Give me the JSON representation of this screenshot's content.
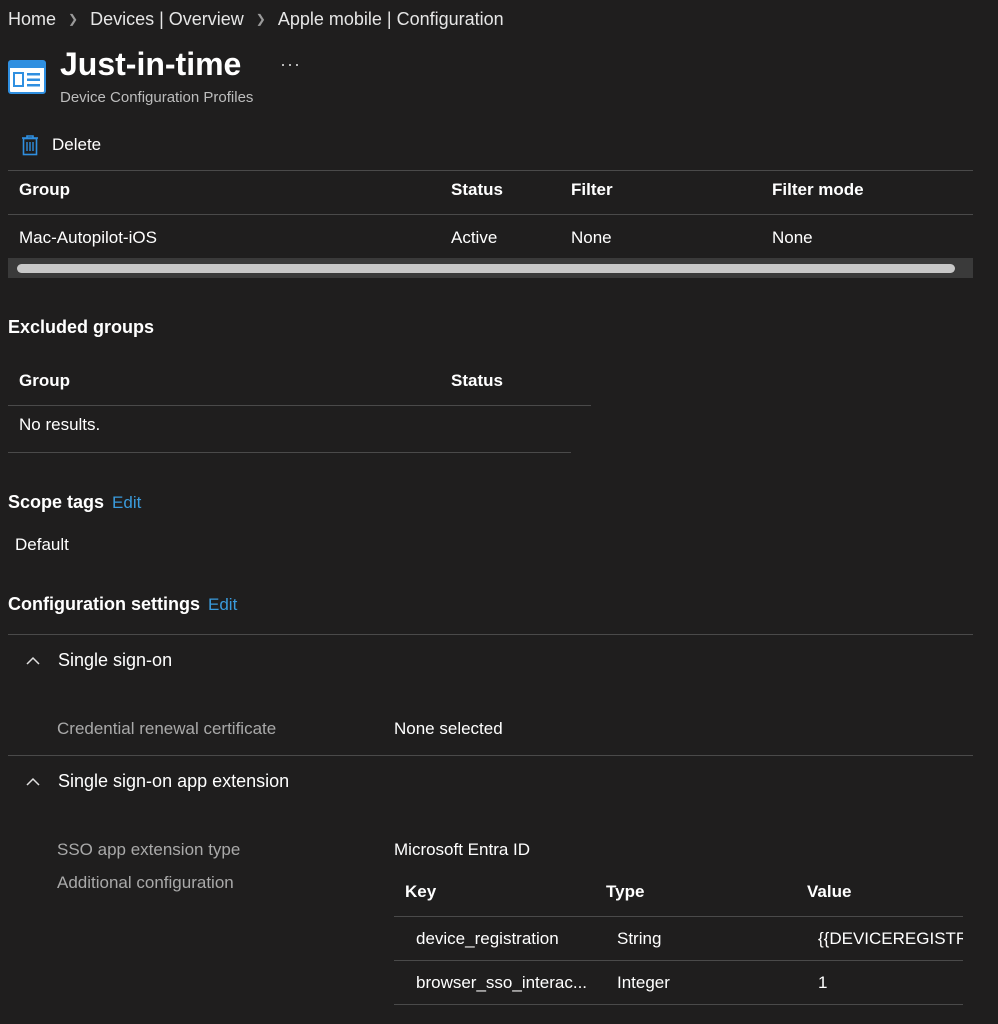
{
  "breadcrumb": {
    "items": [
      "Home",
      "Devices | Overview",
      "Apple mobile | Configuration"
    ]
  },
  "header": {
    "title": "Just-in-time",
    "subtitle": "Device Configuration Profiles",
    "more_label": "···",
    "icon": "profile-window-icon"
  },
  "toolbar": {
    "delete_label": "Delete",
    "delete_icon": "trash-icon"
  },
  "included_groups": {
    "columns": [
      "Group",
      "Status",
      "Filter",
      "Filter mode"
    ],
    "rows": [
      [
        "Mac-Autopilot-iOS",
        "Active",
        "None",
        "None"
      ]
    ]
  },
  "excluded_groups": {
    "title": "Excluded groups",
    "columns": [
      "Group",
      "Status"
    ],
    "empty_text": "No results."
  },
  "scope_tags": {
    "title": "Scope tags",
    "edit_label": "Edit",
    "value": "Default"
  },
  "configuration_settings": {
    "title": "Configuration settings",
    "edit_label": "Edit",
    "sections": [
      {
        "title": "Single sign-on",
        "rows": [
          {
            "label": "Credential renewal certificate",
            "value": "None selected"
          }
        ]
      },
      {
        "title": "Single sign-on app extension",
        "rows": [
          {
            "label": "SSO app extension type",
            "value": "Microsoft Entra ID"
          },
          {
            "label": "Additional configuration",
            "value": ""
          }
        ],
        "table": {
          "columns": [
            "Key",
            "Type",
            "Value"
          ],
          "rows": [
            [
              "device_registration",
              "String",
              "{{DEVICEREGISTRA"
            ],
            [
              "browser_sso_interac...",
              "Integer",
              "1"
            ]
          ]
        }
      }
    ]
  },
  "colors": {
    "background": "#1f1e1e",
    "link": "#3a9bdc",
    "icon_blue": "#2f8fe0"
  }
}
